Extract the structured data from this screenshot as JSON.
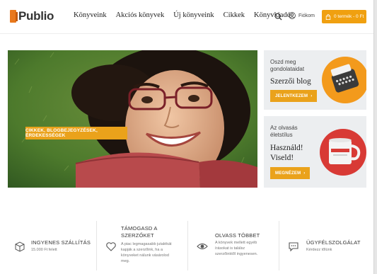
{
  "brand": {
    "logo_text": "Publio",
    "accent": "#eaa21b",
    "logo_color": "#e8781c"
  },
  "nav": [
    {
      "label": "Könyveink"
    },
    {
      "label": "Akciós könyvek"
    },
    {
      "label": "Új könyveink"
    },
    {
      "label": "Cikkek"
    },
    {
      "label": "Könyvkiadó"
    }
  ],
  "header": {
    "search_icon": "search-icon",
    "account_label": "Fiókom",
    "cart_label": "0 termék - 0 Ft"
  },
  "hero": {
    "button_label": "CIKKEK, BLOGBEJEGYZÉSEK, ÉRDEKESSÉGEK"
  },
  "promos": [
    {
      "small_lines": [
        "Oszd meg",
        "gondolataidat"
      ],
      "big_lines": [
        "Szerzői blog"
      ],
      "button_label": "JELENTKEZEM",
      "button_icon": "chevron-right-icon"
    },
    {
      "small_lines": [
        "Az olvasás",
        "életstílus"
      ],
      "big_lines": [
        "Használd!",
        "Viseld!"
      ],
      "button_label": "MEGNÉZEM",
      "button_icon": "chevron-right-icon"
    }
  ],
  "features": [
    {
      "icon": "box-icon",
      "title_lines": [
        "INGYENES SZÁLLÍTÁS"
      ],
      "desc_lines": [
        "15.000 Ft felett"
      ]
    },
    {
      "icon": "heart-icon",
      "title_lines": [
        "TÁMOGASD A",
        "SZERZŐKET"
      ],
      "desc_lines": [
        "A piac legmagasabb jutalékát",
        "kapják a szerzőink, ha a",
        "könyveket nálunk vásárolod",
        "meg."
      ]
    },
    {
      "icon": "eye-icon",
      "title_lines": [
        "OLVASS TÖBBET"
      ],
      "desc_lines": [
        "A könyvek mellett egyéb",
        "írásokat is találsz",
        "szerzőinktől ingyenesen."
      ]
    },
    {
      "icon": "chat-icon",
      "title_lines": [
        "ÜGYFÉLSZOLGÁLAT"
      ],
      "desc_lines": [
        "Kérdezz tőlünk"
      ]
    }
  ]
}
